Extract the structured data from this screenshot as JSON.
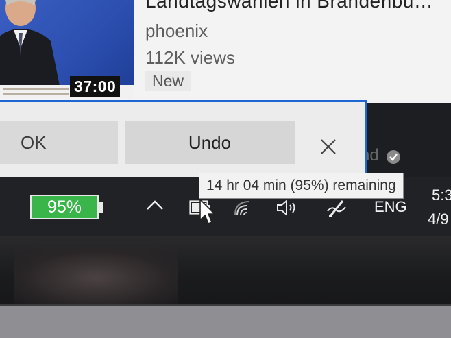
{
  "video": {
    "title": "Landtagswahlen in Brandenbu…",
    "channel": "phoenix",
    "views": "112K views",
    "badge": "New",
    "duration": "37:00"
  },
  "toast": {
    "ok_label": "OK",
    "undo_label": "Undo",
    "behind_text": "nd"
  },
  "taskbar": {
    "battery_percent_label": "95%",
    "battery_level": 0.95,
    "battery_color": "#39b54a",
    "tooltip": "14 hr 04 min (95%) remaining",
    "language": "ENG",
    "time": "5:3",
    "date": "4/9",
    "icons": [
      "chevron-up-icon",
      "battery-icon",
      "wifi-icon",
      "volume-icon",
      "pen-icon"
    ]
  },
  "colors": {
    "accent": "#1e66d4",
    "taskbar_bg": "#202226"
  }
}
